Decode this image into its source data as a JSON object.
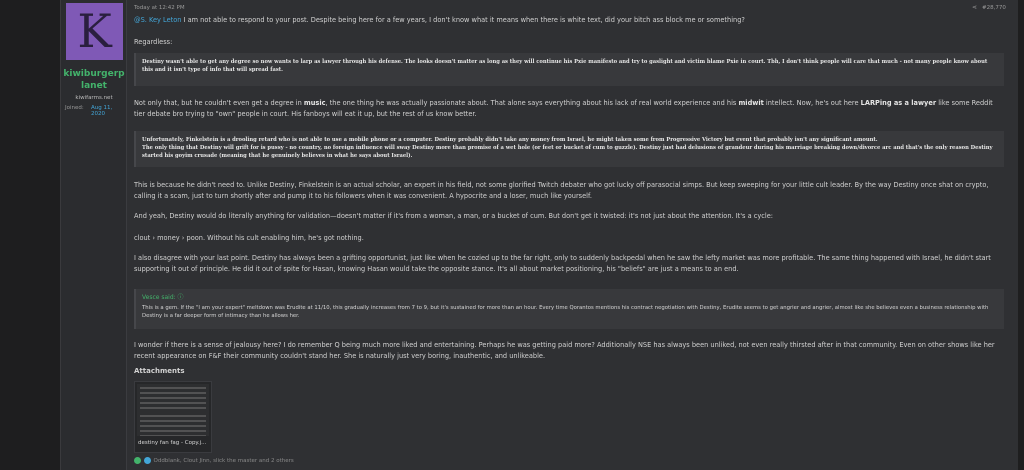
{
  "user": {
    "avatar_letter": "K",
    "name": "kiwiburgerplanet",
    "title": "kiwifarms.net",
    "joined_label": "Joined:",
    "joined_value": "Aug 11, 2020"
  },
  "post": {
    "timestamp": "Today at 12:42 PM",
    "number": "#28,770",
    "mention": "@S. Key Leton",
    "p1": "I am not able to respond to your post. Despite being here for a few years, I don't know what it means when there is white text, did your bitch ass block me or something?",
    "p2": "Regardless:",
    "quote1": "Destiny wasn't able to get any degree so now wants to larp as lawyer through his defense. The looks doesn't matter as long as they will continue his Pxie manifesto and try to gaslight and victim blame Pxie in court. Tbh, I don't think people will care that much - not many people know about this and it isn't type of info that will spread fast.",
    "p3a": "Not only that, but he couldn't even get a degree in ",
    "p3b": "music",
    "p3c": ", the one thing he was actually passionate about. That alone says everything about his lack of real world experience and his ",
    "p3d": "midwit",
    "p3e": " intellect. Now, he's out here ",
    "p3f": "LARPing as a lawyer",
    "p3g": " like some Reddit tier debate bro trying to \"own\" people in court. His fanboys will eat it up, but the rest of us know better.",
    "quote2_line1": "Unfortunately, Finkelstein is a drooling retard who is not able to use a mobile phone or a computer. Destiny probably didn't take any money from Israel, he might taken some from Progressive Victory but event that probably isn't any significant amount.",
    "quote2_line2": "The only thing that Destiny will grift for is pussy - no country, no foreign influence will sway Destiny more than promise of a wet hole (or feet or bucket of cum to guzzle). Destiny just had delusions of grandeur during his marriage breaking down/divorce arc and that's the only reason Destiny started his goyim crusade (meaning that he genuinely believes in what he says about Israel).",
    "p4": "This is because he didn't need to. Unlike Destiny, Finkelstein is an actual scholar, an expert in his field, not some glorified Twitch debater who got lucky off parasocial simps. But keep sweeping for your little cult leader. By the way Destiny once shat on crypto, calling it a scam, just to turn shortly after and pump it to his followers when it was convenient. A hypocrite and a loser, much like yourself.",
    "p5": "And yeah, Destiny would do literally anything for validation—doesn't matter if it's from a woman, a man, or a bucket of cum. But don't get it twisted: it's not just about the attention. It's a cycle:",
    "p6": "clout › money › poon. Without his cult enabling him, he's got nothing.",
    "p7": "I also disagree with your last point. Destiny has always been a grifting opportunist, just like when he cozied up to the far right, only to suddenly backpedal when he saw the lefty market was more profitable. The same thing happened with Israel, he didn't start supporting it out of principle. He did it out of spite for Hasan, knowing Hasan would take the opposite stance. It's all about market positioning, his \"beliefs\" are just a means to an end.",
    "quote3_author": "Vesce said: ⓘ",
    "quote3": "This is a gem. If the \"I am your expert\" meltdown was Erudite at 11/10, this gradually increases from 7 to 9, but it's sustained for more than an hour. Every time Qorantos mentions his contract negotiation with Destiny, Erudite seems to get angrier and angrier, almost like she believes even a business relationship with Destiny is a far deeper form of intimacy than he allows her.",
    "p8": "I wonder if there is a sense of jealousy here? I do remember Q being much more liked and entertaining. Perhaps he was getting paid more? Additionally NSE has always been unliked, not even really thirsted after in that community. Even on other shows like her recent appearance on F&F their community couldn't stand her. She is naturally just very boring, inauthentic, and unlikeable.",
    "attachments_label": "Attachments",
    "attachment_name": "destiny fan fag - Copy.j...",
    "reactions": "Oddblank, Clout Jinn, slick the master and 2 others"
  },
  "colors": {
    "accent_green": "#43b36b",
    "link_blue": "#43a6d8",
    "avatar_bg": "#7f59b6"
  }
}
